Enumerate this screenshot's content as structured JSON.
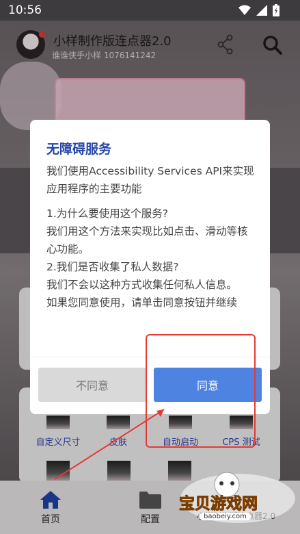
{
  "status_bar": {
    "time": "10:56"
  },
  "app": {
    "title": "小样制作版连点器2.0",
    "subtitle": "谁谁侠手小样 1076141242"
  },
  "dialog": {
    "title": "无障碍服务",
    "lines": [
      "我们使用Accessibility Services API来实现应用程序的主要功能",
      "1.为什么要使用这个服务?",
      "我们用这个方法来实现比如点击、滑动等核心功能。",
      "2.我们是否收集了私人数据?",
      "我们不会以这种方式收集任何私人信息。",
      "如果您同意使用，请单击同意按钮并继续"
    ],
    "disagree_label": "不同意",
    "agree_label": "同意"
  },
  "grid": {
    "items": [
      "自定义尺寸",
      "皮肤",
      "自动启动",
      "CPS 测试"
    ]
  },
  "bottom_nav": {
    "items": [
      {
        "label": "首页",
        "icon": "home-icon"
      },
      {
        "label": "配置",
        "icon": "folder-icon"
      },
      {
        "label": "小样制作版连点器2.0",
        "icon": "app-icon"
      }
    ]
  },
  "watermark": {
    "text": "宝贝游戏网",
    "url": "baobeiy.com"
  },
  "colors": {
    "accent": "#4e83e1",
    "title_blue": "#2547a7",
    "annotation_red": "#e53935",
    "watermark_orange": "#f4a11b"
  }
}
